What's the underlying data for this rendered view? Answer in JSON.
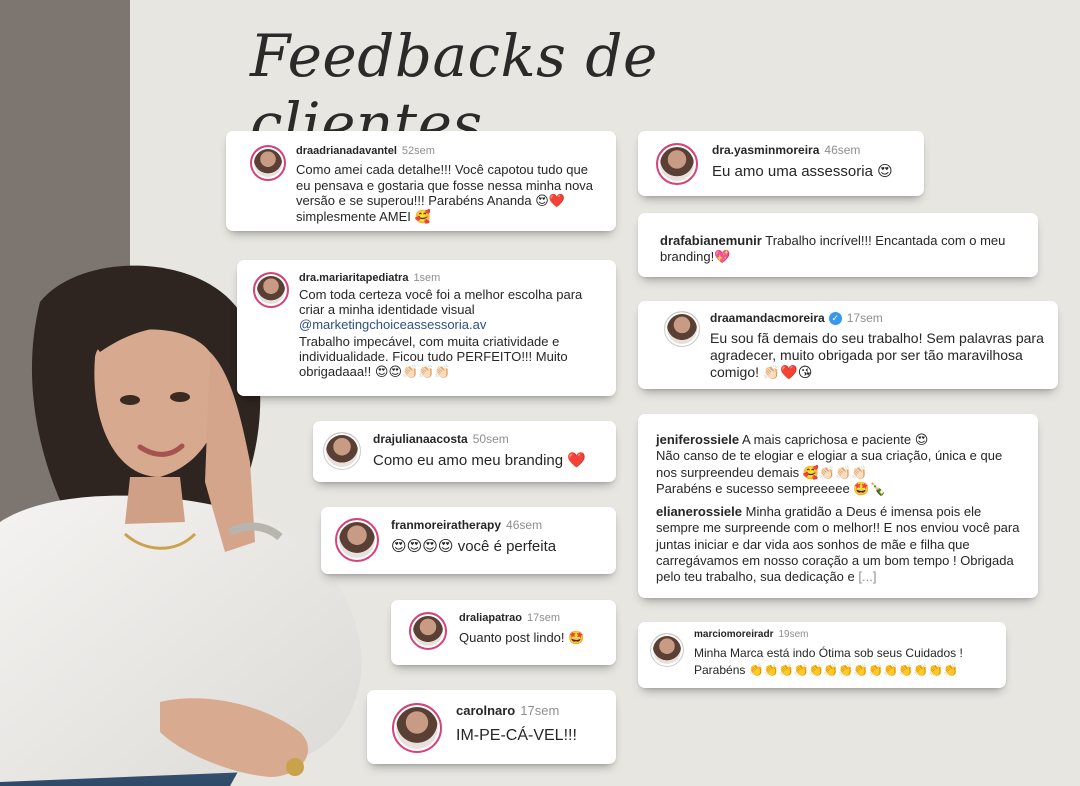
{
  "title": "Feedbacks de clientes",
  "comments": {
    "c1": {
      "user": "draadrianadavantel",
      "time": "52sem",
      "text": "Como amei cada detalhe!!! Você capotou tudo que eu pensava e gostaria que fosse nessa minha nova versão e se superou!!! Parabéns Ananda 😍❤️ simplesmente AMEI 🥰"
    },
    "c2": {
      "user": "dra.mariaritapediatra",
      "time": "1sem",
      "text1": "Com toda certeza você foi a melhor escolha para criar a minha identidade visual",
      "mention": "@marketingchoiceassessoria.av",
      "text2": "Trabalho impecável, com muita criatividade e individualidade. Ficou tudo PERFEITO!!! Muito obrigadaaa!! 😍😍👏🏻👏🏻👏🏻"
    },
    "c3": {
      "user": "drajulianaacosta",
      "time": "50sem",
      "text": "Como eu amo meu branding ❤️"
    },
    "c4": {
      "user": "franmoreiratherapy",
      "time": "46sem",
      "text": "😍😍😍😍 você é perfeita"
    },
    "c5": {
      "user": "draliapatrao",
      "time": "17sem",
      "text": "Quanto post lindo! 🤩"
    },
    "c6": {
      "user": "carolnaro",
      "time": "17sem",
      "text": "IM-PE-CÁ-VEL!!!"
    },
    "c7": {
      "user": "dra.yasminmoreira",
      "time": "46sem",
      "text": "Eu amo uma assessoria 😍"
    },
    "c8": {
      "user": "drafabianemunir",
      "text": "Trabalho incrível!!! Encantada com o meu branding!💖"
    },
    "c9": {
      "user": "draamandacmoreira",
      "time": "17sem",
      "text": "Eu sou fã demais do seu trabalho! Sem palavras para agradecer, muito obrigada por ser tão maravilhosa comigo! 👏🏻❤️😘"
    },
    "c10": {
      "user1": "jeniferossiele",
      "text1": "A mais caprichosa e paciente 😍",
      "text1b": "Não canso de te elogiar e elogiar a sua criação, única e que nos surpreendeu demais 🥰👏🏻👏🏻👏🏻",
      "text1c": "Parabéns e sucesso sempreeeee 🤩🍾",
      "user2": "elianerossiele",
      "text2": "Minha gratidão a Deus é imensa pois ele sempre me surpreende com o melhor!! E nos enviou você para juntas iniciar e dar vida aos sonhos de mãe e filha que carregávamos em nosso coração a um bom tempo ! Obrigada pelo teu trabalho, sua dedicação e",
      "more": "[...]"
    },
    "c11": {
      "user": "marciomoreiradr",
      "time": "19sem",
      "text1": "Minha Marca está indo Ótima sob seus Cuidados !",
      "text2": "Parabéns 👏👏👏👏👏👏👏👏👏👏👏👏👏👏"
    }
  },
  "colors": {
    "background": "#e7e6e1",
    "side_band": "#7d756f",
    "card": "#ffffff",
    "avatar_ring": "#d9417b",
    "mention": "#2d4f86",
    "verified": "#3897f0"
  },
  "icons": {
    "verified": "verified-badge-icon"
  }
}
